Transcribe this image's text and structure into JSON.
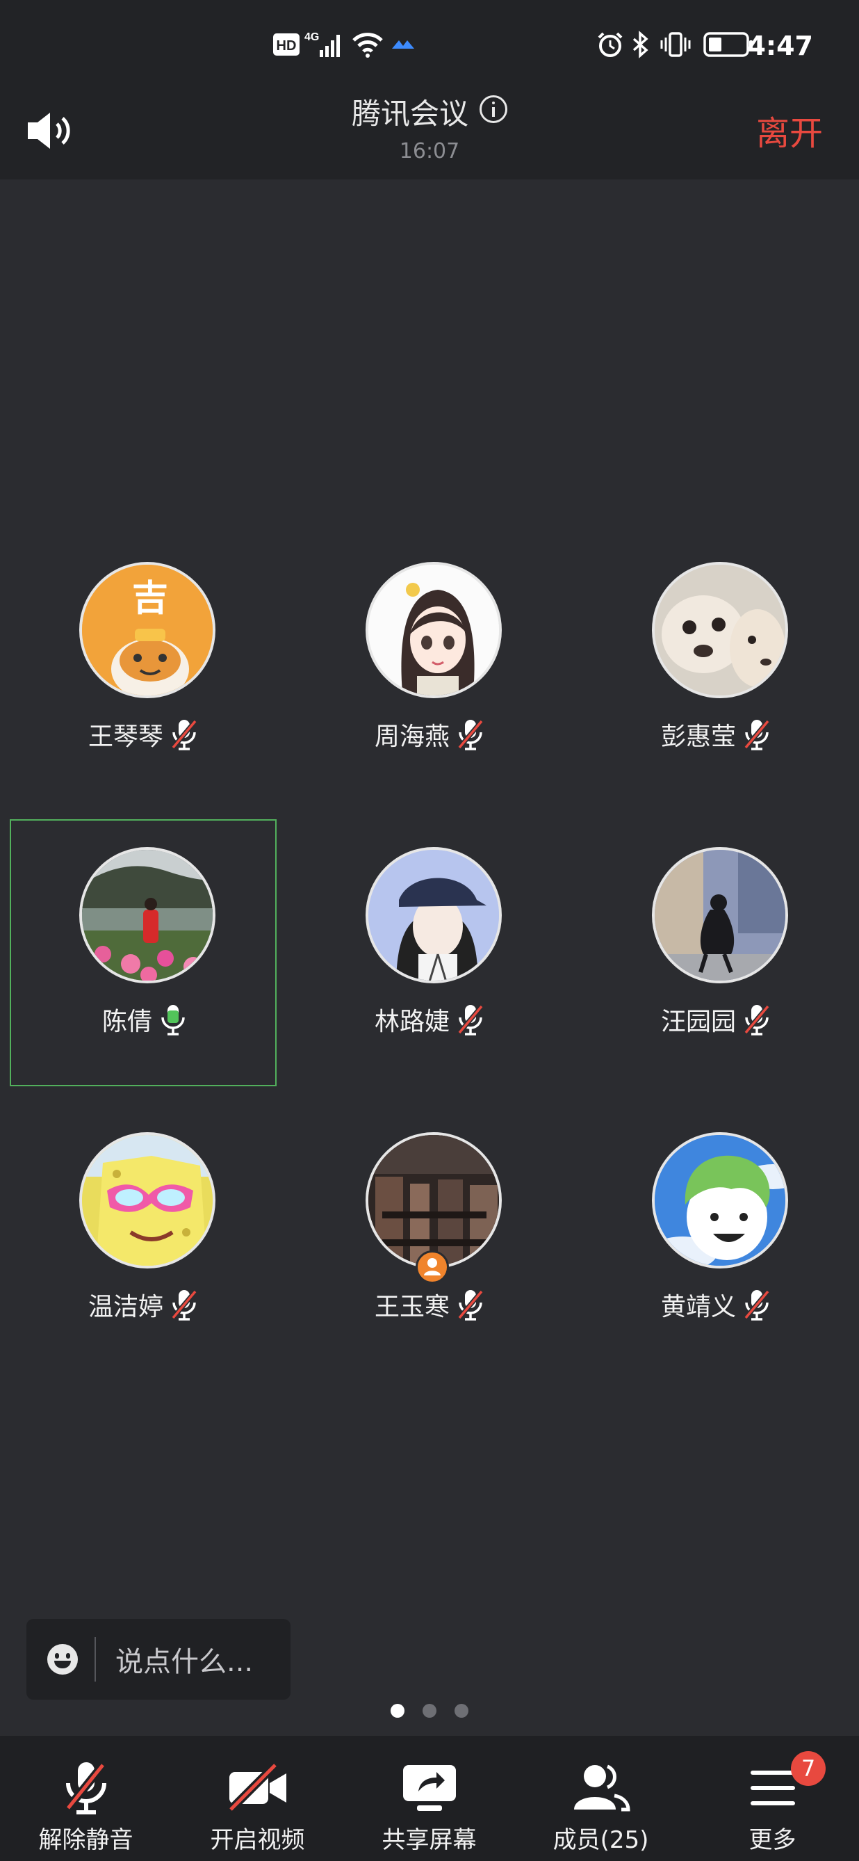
{
  "status_bar": {
    "time": "4:47",
    "hd_label": "HD",
    "network_label": "4G"
  },
  "header": {
    "title": "腾讯会议",
    "timer": "16:07",
    "leave_label": "离开"
  },
  "participants": [
    {
      "name": "王琴琴",
      "mic": "muted",
      "active": false
    },
    {
      "name": "周海燕",
      "mic": "muted",
      "active": false
    },
    {
      "name": "彭惠莹",
      "mic": "muted",
      "active": false
    },
    {
      "name": "陈倩",
      "mic": "on",
      "active": true
    },
    {
      "name": "林路婕",
      "mic": "muted",
      "active": false
    },
    {
      "name": "汪园园",
      "mic": "muted",
      "active": false
    },
    {
      "name": "温洁婷",
      "mic": "muted",
      "active": false
    },
    {
      "name": "王玉寒",
      "mic": "muted",
      "active": false,
      "host": true
    },
    {
      "name": "黄靖义",
      "mic": "muted",
      "active": false
    }
  ],
  "chat": {
    "placeholder": "说点什么..."
  },
  "pagination": {
    "pages": 3,
    "current": 1
  },
  "toolbar": {
    "unmute_label": "解除静音",
    "video_label": "开启视频",
    "share_label": "共享屏幕",
    "members_label": "成员(25)",
    "more_label": "更多",
    "more_badge": "7"
  },
  "colors": {
    "background": "#2b2c30",
    "header": "#222326",
    "leave": "#e8493f",
    "active_border": "#52b05c",
    "mic_on": "#52c45a",
    "mute_slash": "#e8493f"
  }
}
